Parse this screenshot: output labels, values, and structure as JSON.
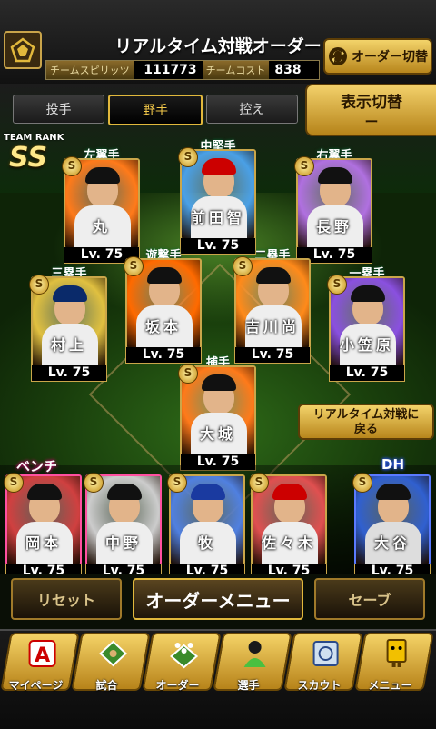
{
  "header": {
    "title": "リアルタイム対戦オーダー",
    "team_spirit_label": "チームスピリッツ",
    "team_spirit_value": "111773",
    "team_cost_label": "チームコスト",
    "team_cost_value": "838",
    "order_switch_label": "オーダー切替"
  },
  "tabs": [
    {
      "label": "投手",
      "active": false
    },
    {
      "label": "野手",
      "active": true
    },
    {
      "label": "控え",
      "active": false
    }
  ],
  "display_switch": {
    "label": "表示切替",
    "value": "ー"
  },
  "team_rank": {
    "label": "TEAM RANK",
    "value": "SS"
  },
  "starters": [
    {
      "position": "左翼手",
      "name": "丸",
      "level": "Lv. 75",
      "badge": "S",
      "color": "#ff7a1a"
    },
    {
      "position": "中堅手",
      "name": "前田智",
      "level": "Lv. 75",
      "badge": "S",
      "color": "#4aa0e6"
    },
    {
      "position": "右翼手",
      "name": "長野",
      "level": "Lv. 75",
      "badge": "S",
      "color": "#b070e0"
    },
    {
      "position": "三塁手",
      "name": "村上",
      "level": "Lv. 75",
      "badge": "S",
      "color": "#e0c040"
    },
    {
      "position": "遊撃手",
      "name": "坂本",
      "level": "Lv. 75",
      "badge": "S",
      "color": "#ff6a00"
    },
    {
      "position": "二塁手",
      "name": "吉川尚",
      "level": "Lv. 75",
      "badge": "S",
      "color": "#ff8a1a"
    },
    {
      "position": "一塁手",
      "name": "小笠原",
      "level": "Lv. 75",
      "badge": "S",
      "color": "#8a50e0"
    },
    {
      "position": "捕手",
      "name": "大城",
      "level": "Lv. 75",
      "badge": "S",
      "color": "#ff7a1a"
    }
  ],
  "return_button": {
    "line1": "リアルタイム対戦に",
    "line2": "戻る"
  },
  "bench": {
    "label": "ベンチ",
    "dh_label": "DH",
    "players": [
      {
        "name": "岡本",
        "level": "Lv. 75",
        "badge": "S",
        "color": "#d04040"
      },
      {
        "name": "中野",
        "level": "Lv. 75",
        "badge": "S",
        "color": "#cccccc"
      },
      {
        "name": "牧",
        "level": "Lv. 75",
        "badge": "S",
        "color": "#5080e0"
      },
      {
        "name": "佐々木",
        "level": "Lv. 75",
        "badge": "S",
        "color": "#e05050"
      },
      {
        "name": "大谷",
        "level": "Lv. 75",
        "badge": "S",
        "color": "#3060d0"
      }
    ]
  },
  "controls": {
    "reset_label": "リセット",
    "order_menu_label": "オーダーメニュー",
    "save_label": "セーブ"
  },
  "nav": [
    {
      "label": "マイページ",
      "icon": "mypage-icon"
    },
    {
      "label": "試合",
      "icon": "stadium-icon"
    },
    {
      "label": "オーダー",
      "icon": "order-icon"
    },
    {
      "label": "選手",
      "icon": "player-icon"
    },
    {
      "label": "スカウト",
      "icon": "scout-icon"
    },
    {
      "label": "メニュー",
      "icon": "menu-icon"
    }
  ],
  "colors": {
    "accent": "#e1b83c",
    "field": "#2e6a18"
  }
}
